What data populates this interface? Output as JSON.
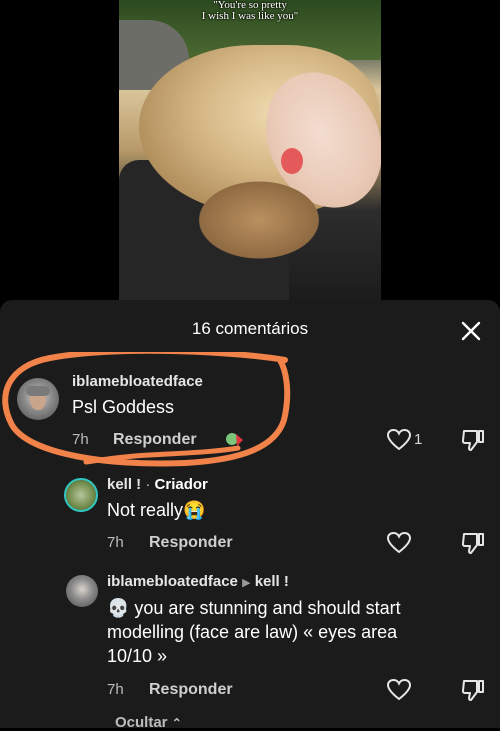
{
  "video": {
    "caption_line1": "\"You're so pretty",
    "caption_line2": "I wish I was like you\""
  },
  "panel": {
    "title": "16 comentários",
    "close_icon": "close-icon"
  },
  "comments": [
    {
      "username": "iblamebloatedface",
      "text": "Psl Goddess",
      "time": "7h",
      "reply_label": "Responder",
      "likes": "1"
    },
    {
      "username": "kell !",
      "separator": " · ",
      "badge": "Criador",
      "text": "Not really😭",
      "time": "7h",
      "reply_label": "Responder"
    },
    {
      "username": "iblamebloatedface",
      "reply_to": "kell !",
      "text": "💀 you are stunning and should start modelling (face are law) « eyes area 10/10 »",
      "time": "7h",
      "reply_label": "Responder"
    }
  ],
  "footer": {
    "hide_label": "Ocultar"
  },
  "colors": {
    "sheet_background": "#1b1b1b",
    "annotation_stroke": "#f0824a"
  }
}
